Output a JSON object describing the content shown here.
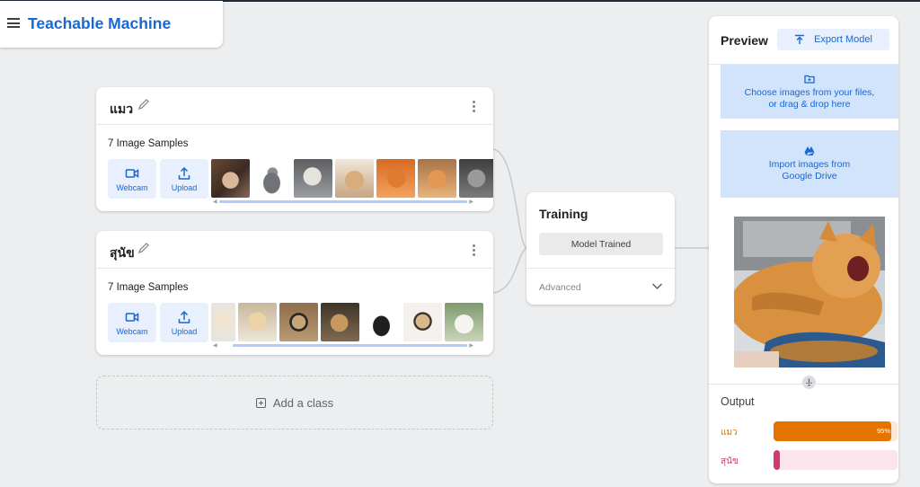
{
  "app": {
    "title": "Teachable Machine"
  },
  "classes": [
    {
      "name": "แมว",
      "samples_label": "7 Image Samples",
      "webcam_label": "Webcam",
      "upload_label": "Upload"
    },
    {
      "name": "สุนัข",
      "samples_label": "7 Image Samples",
      "webcam_label": "Webcam",
      "upload_label": "Upload"
    }
  ],
  "add_class": {
    "label": "Add a class"
  },
  "training": {
    "title": "Training",
    "status_button": "Model Trained",
    "advanced_label": "Advanced"
  },
  "preview": {
    "title": "Preview",
    "export_label": "Export Model",
    "choose_files_line1": "Choose images from your files,",
    "choose_files_line2": "or drag & drop here",
    "drive_line1": "Import images from",
    "drive_line2": "Google Drive",
    "output_label": "Output",
    "outputs": [
      {
        "name": "แมว",
        "percent_label": "95%",
        "value": 0.95,
        "color": "#e37400",
        "track": "#fde7d2"
      },
      {
        "name": "สุนัข",
        "percent_label": "",
        "value": 0.05,
        "color": "#d33a6a",
        "track": "#fce4ec"
      }
    ]
  },
  "colors": {
    "accent": "#1967d2",
    "accent_light": "#e8f0fe",
    "drop_zone": "#d2e3fc"
  }
}
